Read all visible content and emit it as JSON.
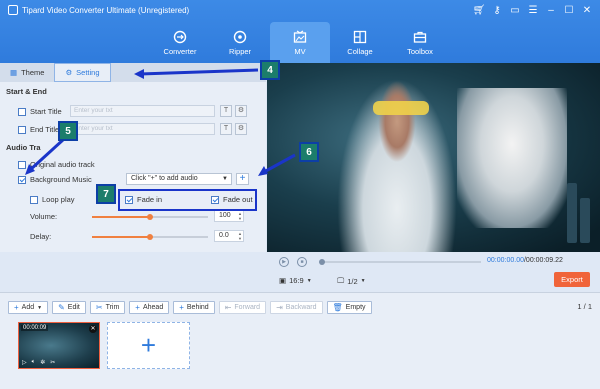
{
  "app": {
    "title": "Tipard Video Converter Ultimate (Unregistered)"
  },
  "nav": [
    {
      "label": "Converter",
      "icon": "converter-icon"
    },
    {
      "label": "Ripper",
      "icon": "ripper-icon"
    },
    {
      "label": "MV",
      "icon": "mv-icon",
      "active": true
    },
    {
      "label": "Collage",
      "icon": "collage-icon"
    },
    {
      "label": "Toolbox",
      "icon": "toolbox-icon"
    }
  ],
  "tabs": {
    "theme": "Theme",
    "setting": "Setting"
  },
  "start_end": {
    "heading": "Start & End",
    "start_label": "Start Title",
    "start_placeholder": "Enter your txt",
    "end_label": "End Title",
    "end_placeholder": "Enter your txt"
  },
  "audio": {
    "heading": "Audio Tra",
    "original_label": "Original audio track",
    "bg_label": "Background Music",
    "dropdown_value": "Click \"+\" to add audio",
    "loop_label": "Loop play",
    "fade_in_label": "Fade in",
    "fade_out_label": "Fade out",
    "volume_label": "Volume:",
    "volume_value": "100",
    "volume_level": 0.5,
    "delay_label": "Delay:",
    "delay_value": "0.0",
    "delay_level": 0.5
  },
  "badges": {
    "b4": "4",
    "b5": "5",
    "b6": "6",
    "b7": "7"
  },
  "player": {
    "current_time": "00:00:00.00",
    "total_time": "/00:00:09.22",
    "ratio": "16:9",
    "page": "1/2",
    "export_label": "Export"
  },
  "toolbar": {
    "add": "Add",
    "edit": "Edit",
    "trim": "Trim",
    "ahead": "Ahead",
    "behind": "Behind",
    "forward": "Forward",
    "backward": "Backward",
    "empty": "Empty",
    "pager": "1 / 1"
  },
  "clip": {
    "time": "00:00:09"
  },
  "colors": {
    "accent": "#2f7bdc",
    "export": "#f0643a",
    "badge": "#1c7d6b",
    "highlight": "#1a35c9"
  }
}
